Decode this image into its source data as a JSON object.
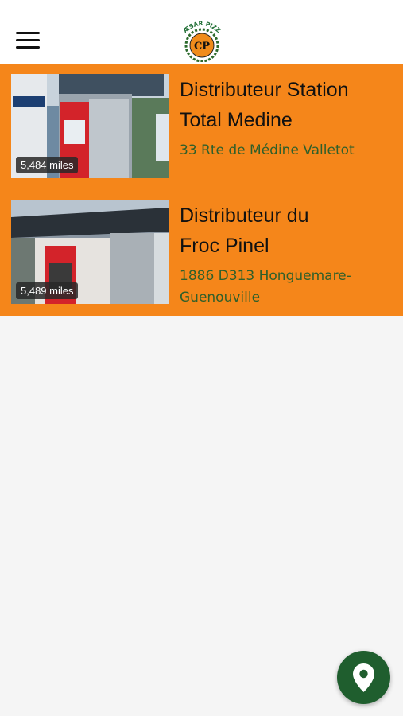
{
  "header": {
    "logo_text": "CÆSAR PIZZA",
    "logo_monogram": "CP"
  },
  "distributors": [
    {
      "title_line1": "Distributeur Station",
      "title_line2": "Total Medine",
      "address_line1": "33 Rte de Médine Valletot",
      "address_line2": "",
      "distance": "5,484 miles"
    },
    {
      "title_line1": "Distributeur du",
      "title_line2": "Froc Pinel",
      "address_line1": "1886 D313 Honguemare-",
      "address_line2": "Guenouville",
      "distance": "5,489 miles"
    }
  ],
  "colors": {
    "card_bg": "#f5861a",
    "address": "#2f5f2a",
    "fab": "#1f5e2e"
  },
  "icons": {
    "menu": "hamburger-menu-icon",
    "fab": "map-pin-icon"
  }
}
